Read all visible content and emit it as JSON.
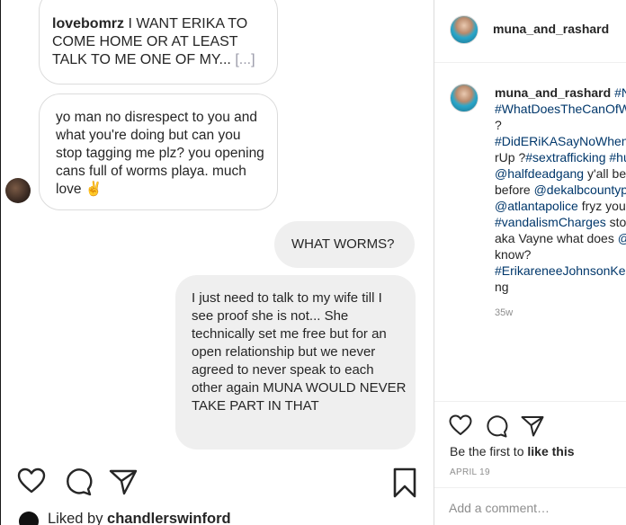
{
  "photo": {
    "messages": {
      "top": {
        "author": "lovebomrz",
        "text": " I WANT ERIKA TO COME HOME OR AT LEAST TALK TO ME ONE OF MY... ",
        "ellipsis": "[...]"
      },
      "mid": {
        "text": "yo man no disrespect to you and what you're doing but can you stop tagging me plz? you opening cans full of worms playa. much love ",
        "emoji": "✌"
      },
      "worms": {
        "text": "WHAT WORMS?"
      },
      "wife": {
        "text": "I just need to talk to my wife till I see proof she is not... She technically set me free but for an open relationship but we never agreed to never speak to each other again MUNA WOULD NEVER TAKE PART IN THAT"
      }
    },
    "liked_by": {
      "prefix": "Liked by ",
      "user": "chandlerswinford"
    }
  },
  "panel": {
    "header": {
      "username": "muna_and_rashard"
    },
    "caption": {
      "username": "muna_and_rashard",
      "lines": [
        [
          "#N"
        ],
        [
          "#WhatDoesTheCanOfW"
        ],
        [
          "?"
        ],
        [
          "#DidERiKASayNoWhen"
        ],
        [
          "rUp",
          " ?",
          "#sextrafficking",
          " ",
          "#hu"
        ],
        [
          "@halfdeadgang",
          " y'all be"
        ],
        [
          "before ",
          "@dekalbcountyp"
        ],
        [
          "@atlantapolice",
          " fryz your"
        ],
        [
          "#vandalismCharges",
          " sto"
        ],
        [
          "aka Vayne what does ",
          "@"
        ],
        [
          "know?"
        ],
        [
          "#ErikareneeJohnsonKe"
        ],
        [
          "ng"
        ]
      ],
      "time": "35w"
    },
    "first_like": {
      "prefix": "Be the first to ",
      "bold": "like this"
    },
    "date": "APRIL 19",
    "comment_placeholder": "Add a comment…"
  },
  "colors": {
    "link": "#00376b",
    "text": "#262626",
    "muted": "#8e8e8e",
    "bubble_gray": "#efefef"
  }
}
